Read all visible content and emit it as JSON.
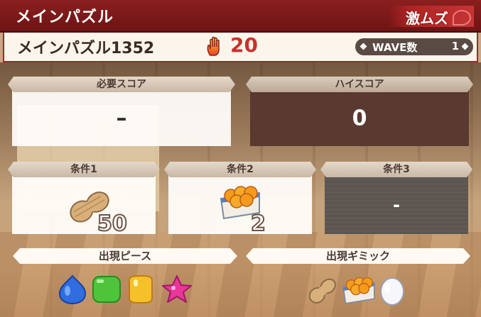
{
  "header": {
    "title": "メインパズル",
    "difficulty": "激ムズ"
  },
  "info": {
    "stage_name": "メインパズル1352",
    "stamina_cost": "20",
    "wave_label": "WAVE数",
    "wave_value": "1"
  },
  "scores": {
    "required": {
      "label": "必要スコア",
      "value": "–"
    },
    "high": {
      "label": "ハイスコア",
      "value": "0"
    }
  },
  "conditions": [
    {
      "label": "条件1",
      "icon": "peanut-icon",
      "count": "50"
    },
    {
      "label": "条件2",
      "icon": "orange-box-icon",
      "count": "2"
    },
    {
      "label": "条件3",
      "value": "-"
    }
  ],
  "pieces": {
    "label": "出現ピース",
    "items": [
      "blue-drop-piece",
      "green-square-piece",
      "yellow-square-piece",
      "pink-star-piece"
    ]
  },
  "gimmicks": {
    "label": "出現ギミック",
    "items": [
      "peanut-icon",
      "orange-box-icon",
      "egg-icon"
    ]
  },
  "colors": {
    "header": "#7a1a1a",
    "stamina": "#c8322b",
    "dark_panel": "#5a3a30"
  }
}
